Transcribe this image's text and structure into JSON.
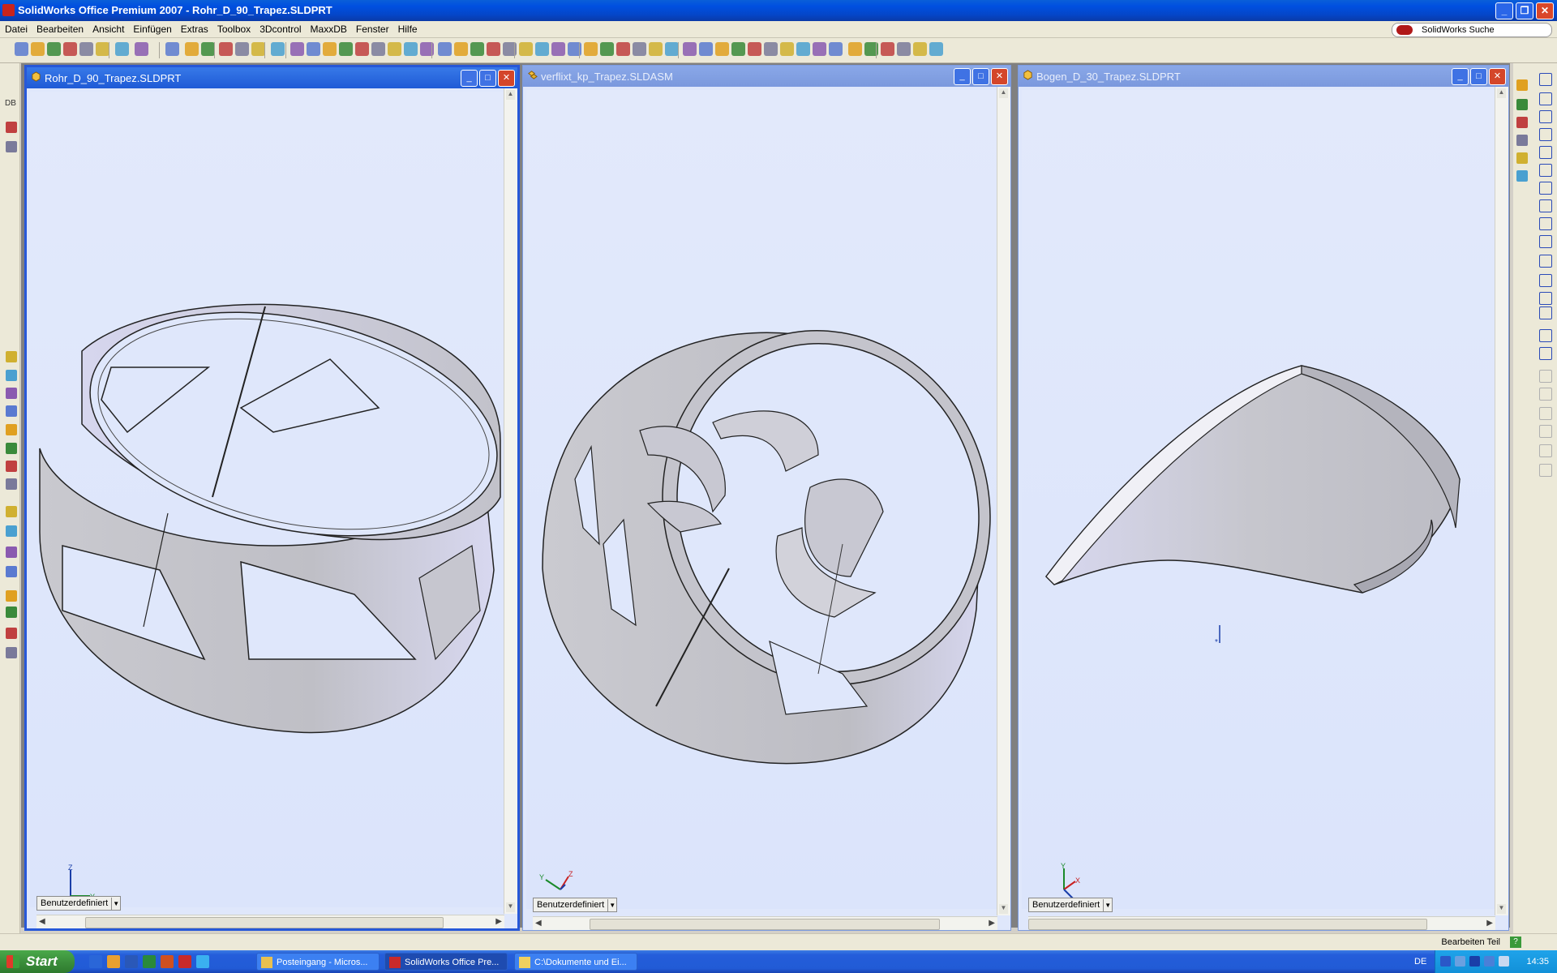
{
  "app": {
    "title": "SolidWorks Office Premium 2007 - Rohr_D_90_Trapez.SLDPRT",
    "search_label": "SolidWorks Suche"
  },
  "menu": [
    "Datei",
    "Bearbeiten",
    "Ansicht",
    "Einfügen",
    "Extras",
    "Toolbox",
    "3Dcontrol",
    "MaxxDB",
    "Fenster",
    "Hilfe"
  ],
  "left_rail_top": {
    "db_label": "DB"
  },
  "windows": [
    {
      "title": "Rohr_D_90_Trapez.SLDPRT",
      "config": "Benutzerdefiniert",
      "active": true
    },
    {
      "title": "verflixt_kp_Trapez.SLDASM",
      "config": "Benutzerdefiniert",
      "active": false
    },
    {
      "title": "Bogen_D_30_Trapez.SLDPRT",
      "config": "Benutzerdefiniert",
      "active": false
    }
  ],
  "status": {
    "text": "Bearbeiten Teil"
  },
  "taskbar": {
    "start_label": "Start",
    "tasks": [
      "Posteingang - Micros...",
      "SolidWorks Office Pre...",
      "C:\\Dokumente und Ei..."
    ],
    "language": "DE",
    "clock": "14:35"
  },
  "colors": {
    "viewport_bg": "#dfe7fb",
    "title_blue": "#0050e0",
    "model_gray": "#c7c7cc"
  }
}
